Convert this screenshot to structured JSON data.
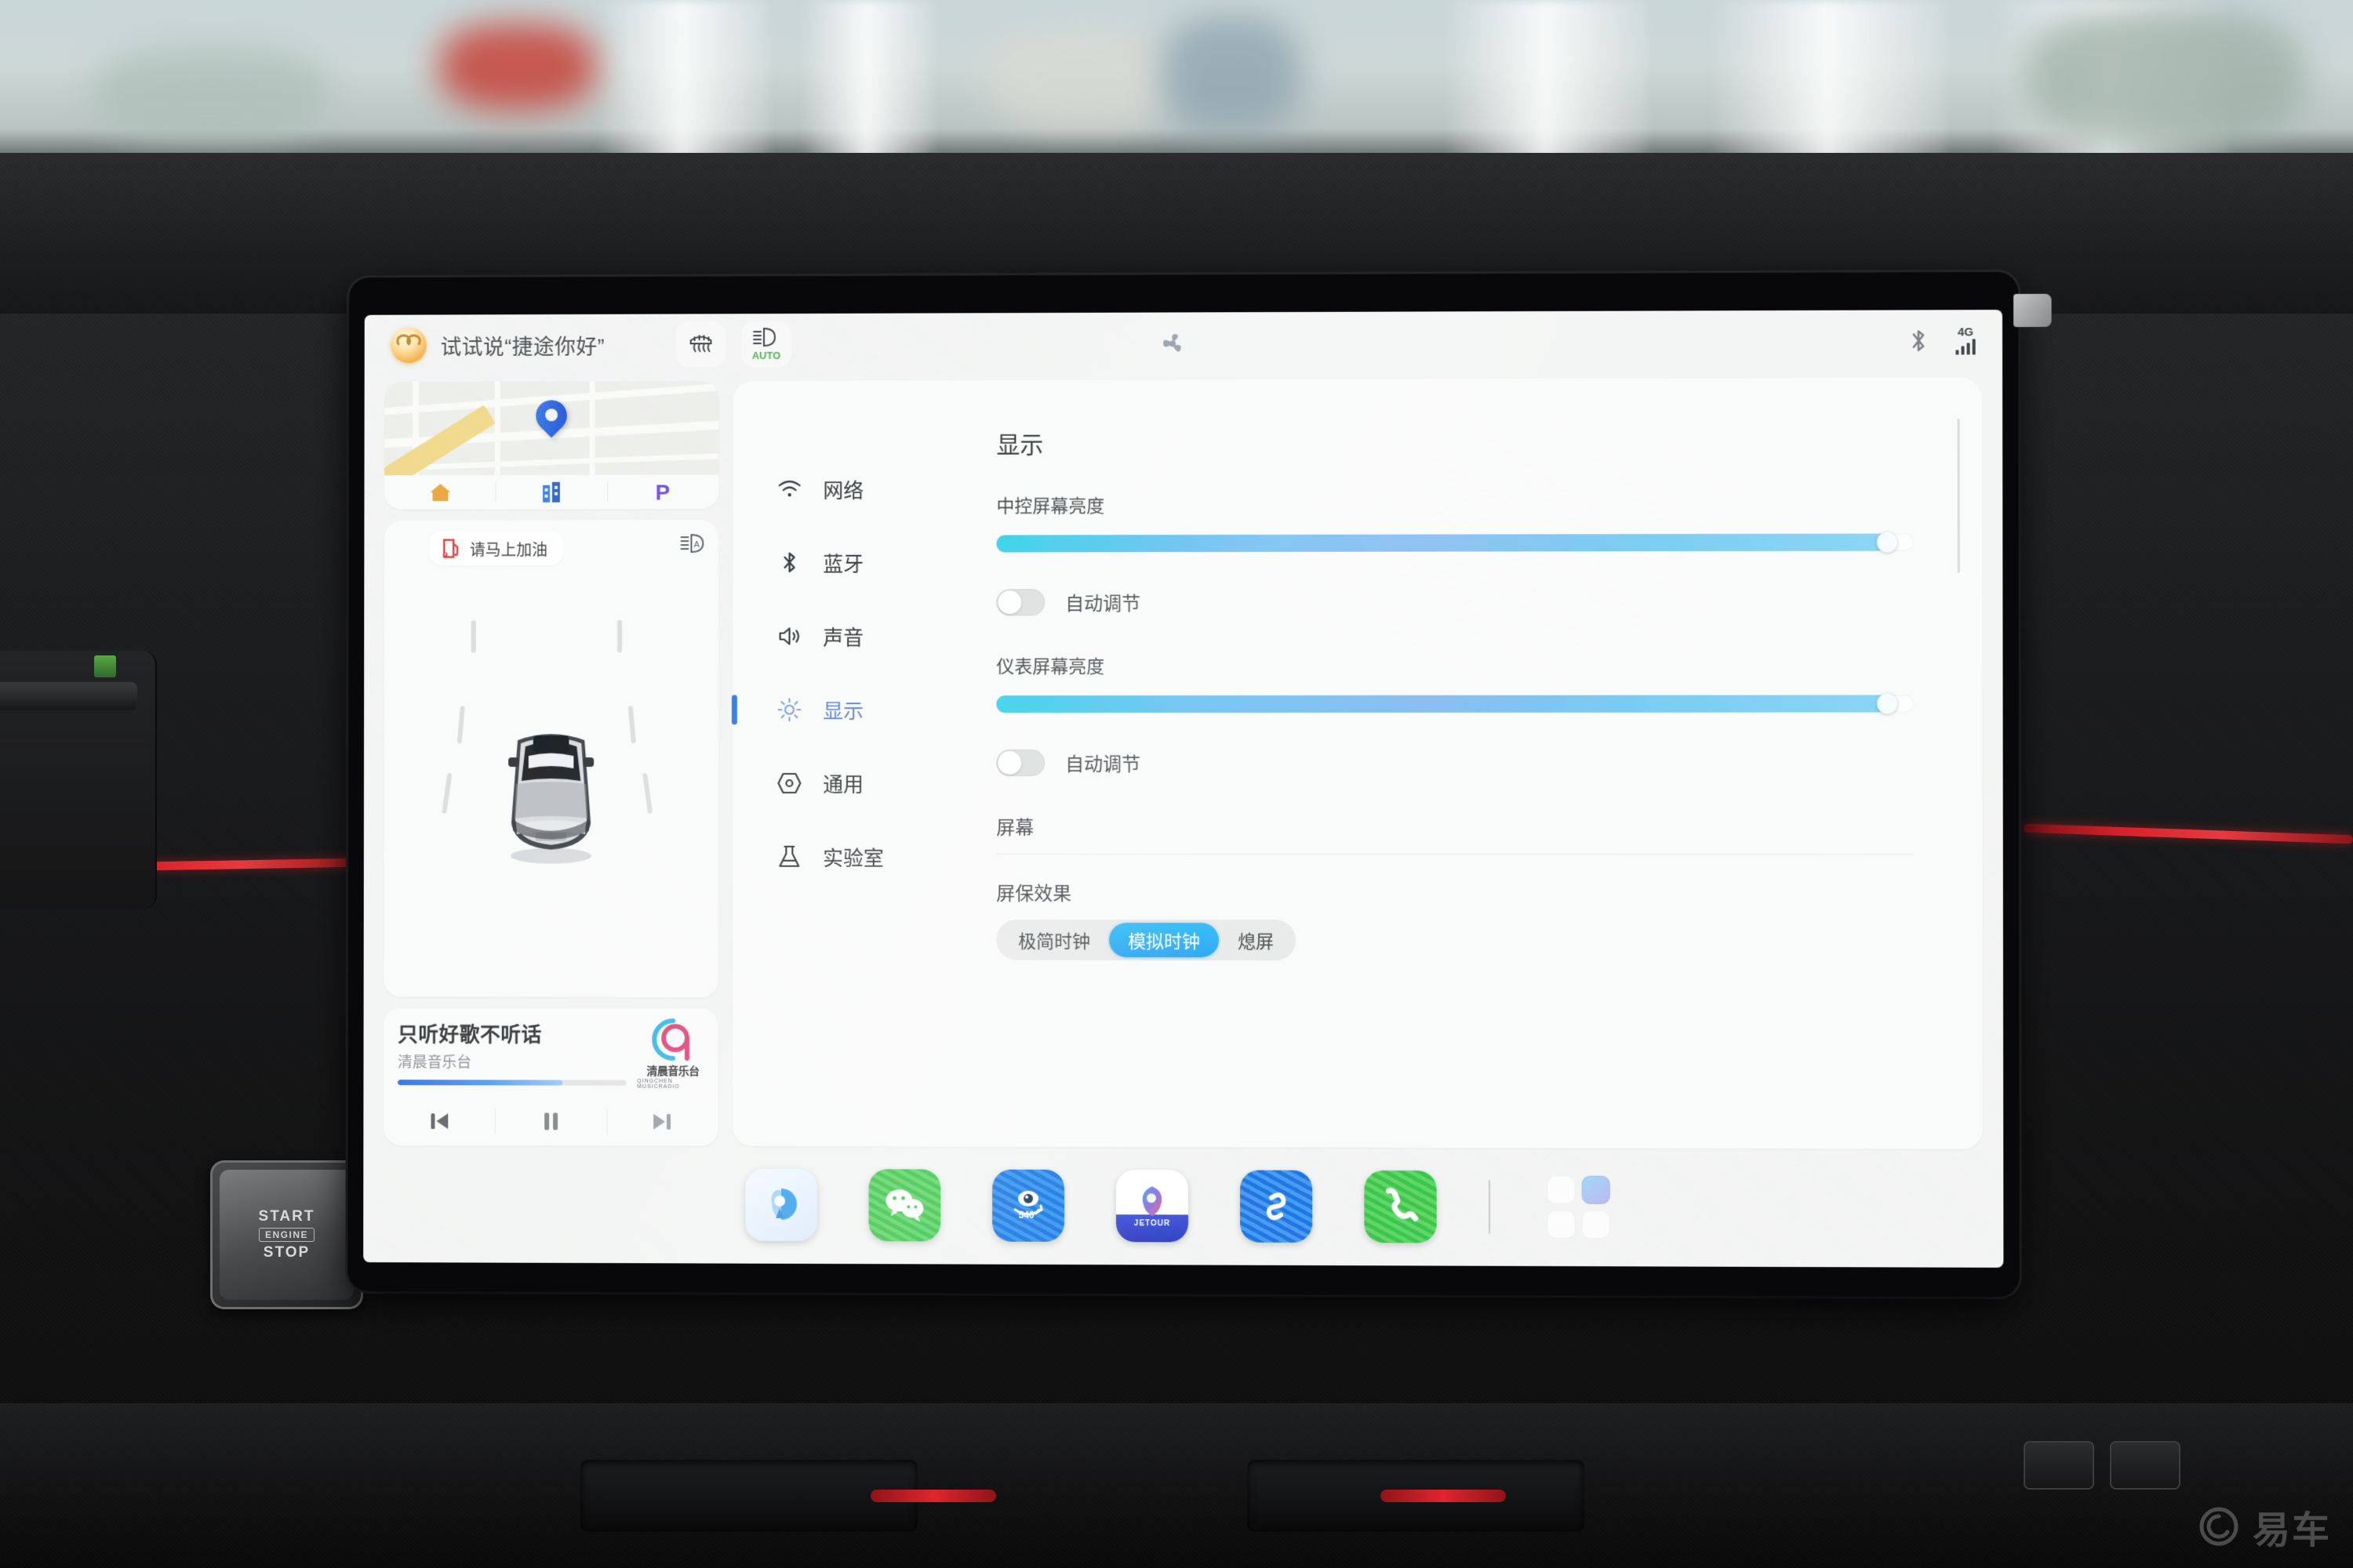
{
  "status_bar": {
    "assistant_icon": "assistant-orb-icon",
    "wake_phrase": "试试说“捷途你好”",
    "rear_defrost_icon": "rear-defrost-icon",
    "auto_headlight_icon": "auto-headlight-icon",
    "auto_headlight_label": "AUTO",
    "fan_icon": "fan-icon",
    "bluetooth_icon": "bluetooth-icon",
    "network_label": "4G",
    "signal_icon": "signal-bars-icon",
    "signal_bars": 4
  },
  "map_card": {
    "name": "map-widget",
    "pin_icon": "location-pin-icon",
    "shortcuts": [
      {
        "icon": "home-icon",
        "label": "家",
        "color": "#e8a63c"
      },
      {
        "icon": "company-building-icon",
        "label": "公司",
        "color": "#3c7ce8"
      },
      {
        "icon": "parking-icon",
        "label": "P",
        "color": "#6a4fe0"
      }
    ]
  },
  "car_card": {
    "fuel_warning_icon": "fuel-pump-icon",
    "fuel_warning_text": "请马上加油",
    "beam_icon": "auto-high-beam-icon",
    "vehicle_icon": "car-top-view-icon"
  },
  "music_card": {
    "title": "只听好歌不听话",
    "station": "清晨音乐台",
    "progress_percent": 72,
    "logo_cn": "清晨音乐台",
    "logo_en": "QINGCHEN MUSICRADIO",
    "controls": [
      {
        "icon": "previous-track-icon",
        "label": "上一首"
      },
      {
        "icon": "pause-icon",
        "label": "暂停"
      },
      {
        "icon": "next-track-icon",
        "label": "下一首"
      }
    ]
  },
  "settings": {
    "nav_items": [
      {
        "icon": "wifi-icon",
        "label": "网络",
        "active": false
      },
      {
        "icon": "bluetooth-icon",
        "label": "蓝牙",
        "active": false
      },
      {
        "icon": "sound-icon",
        "label": "声音",
        "active": false
      },
      {
        "icon": "brightness-icon",
        "label": "显示",
        "active": true
      },
      {
        "icon": "general-gear-icon",
        "label": "通用",
        "active": false
      },
      {
        "icon": "lab-flask-icon",
        "label": "实验室",
        "active": false
      }
    ],
    "page_title": "显示",
    "center_brightness": {
      "label": "中控屏幕亮度",
      "value_percent": 98,
      "auto_label": "自动调节",
      "auto_enabled": false
    },
    "cluster_brightness": {
      "label": "仪表屏幕亮度",
      "value_percent": 98,
      "auto_label": "自动调节",
      "auto_enabled": false
    },
    "screen_section_title": "屏幕",
    "screensaver": {
      "label": "屏保效果",
      "options": [
        "极简时钟",
        "模拟时钟",
        "熄屏"
      ],
      "selected": "模拟时钟"
    },
    "accent_color": "#1f9ff0"
  },
  "dock": {
    "apps": [
      {
        "icon": "baidu-maps-icon",
        "label": "百度地图"
      },
      {
        "icon": "wechat-icon",
        "label": "微信"
      },
      {
        "icon": "camera-540-icon",
        "label": "540°全景"
      },
      {
        "icon": "jetour-app-icon",
        "label": "JETOUR"
      },
      {
        "icon": "link-share-icon",
        "label": "互联"
      },
      {
        "icon": "phone-icon",
        "label": "电话"
      }
    ],
    "app_grid_icon": "app-grid-icon"
  },
  "vehicle_controls": {
    "start_stop_line1": "START",
    "start_stop_line2": "ENGINE",
    "start_stop_line3": "STOP"
  },
  "watermark": {
    "icon": "yiche-logo-icon",
    "text": "易车"
  }
}
